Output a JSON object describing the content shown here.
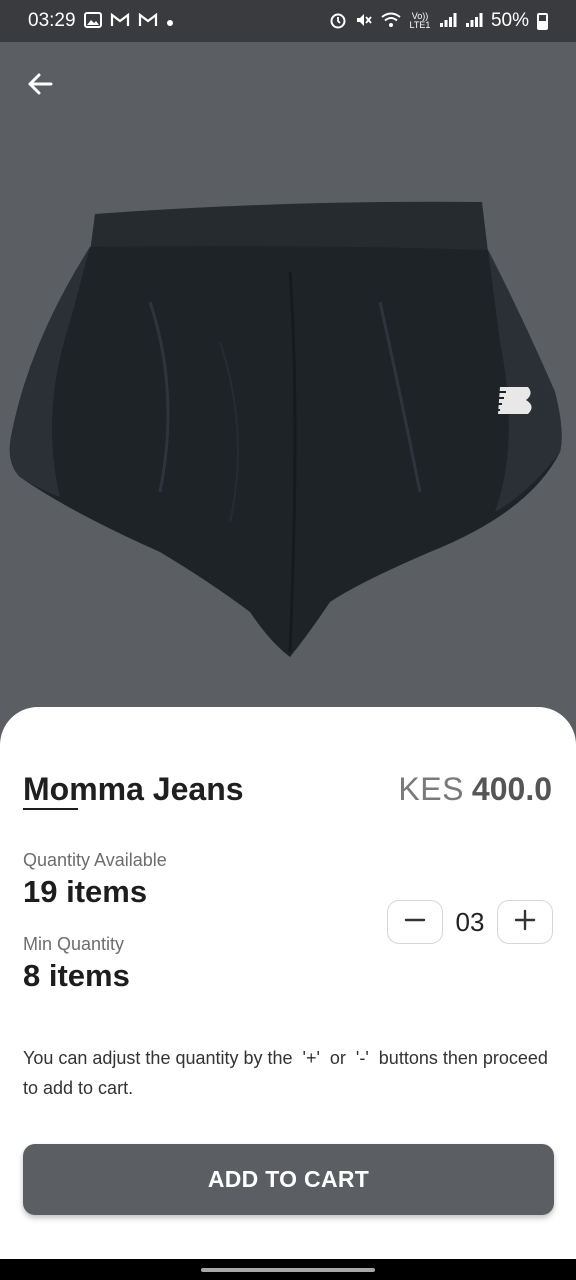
{
  "status_bar": {
    "time": "03:29",
    "battery": "50%",
    "left_icons": [
      "gallery-icon",
      "gmail-icon",
      "gmail-icon",
      "dot-icon"
    ],
    "right_icons": [
      "alarm-icon",
      "mute-icon",
      "wifi-icon",
      "volte-icon",
      "signal-icon",
      "signal-icon",
      "battery-icon"
    ],
    "volte_label": "Vo)) LTE1"
  },
  "product": {
    "name": "Momma Jeans",
    "currency": "KES",
    "price": "400.0"
  },
  "stock": {
    "available_label": "Quantity Available",
    "available_value": "19 items",
    "min_label": "Min Quantity",
    "min_value": "8 items"
  },
  "quantity": {
    "value": "03"
  },
  "hint": {
    "text": "You can adjust the quantity by the  '+'  or  '-'  buttons then proceed to add to cart."
  },
  "cta": {
    "label": "ADD TO CART"
  },
  "colors": {
    "hero_bg": "#5b5e62",
    "button_bg": "#5b5e62",
    "status_bar": "#3a3b3e"
  }
}
